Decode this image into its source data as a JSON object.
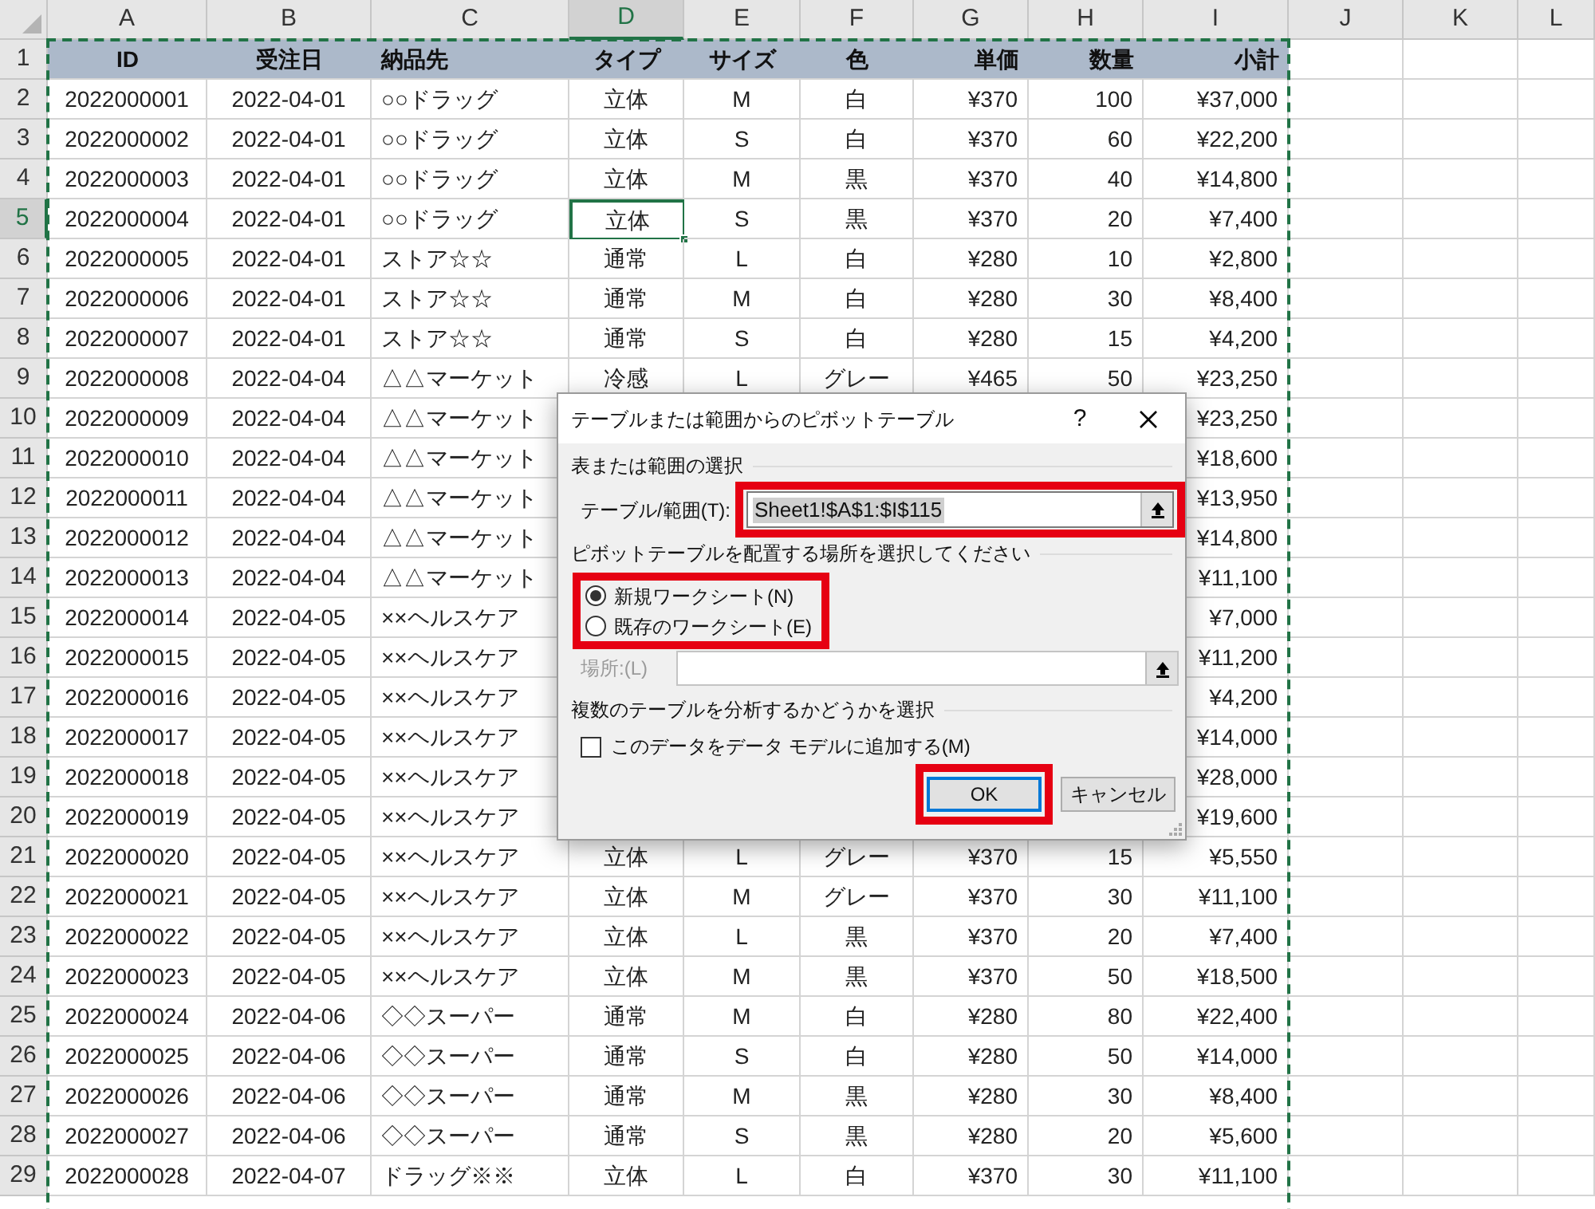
{
  "sheet": {
    "columns": [
      {
        "label": "A",
        "selected": false
      },
      {
        "label": "B",
        "selected": false
      },
      {
        "label": "C",
        "selected": false
      },
      {
        "label": "D",
        "selected": true
      },
      {
        "label": "E",
        "selected": false
      },
      {
        "label": "F",
        "selected": false
      },
      {
        "label": "G",
        "selected": false
      },
      {
        "label": "H",
        "selected": false
      },
      {
        "label": "I",
        "selected": false
      },
      {
        "label": "J",
        "selected": false
      },
      {
        "label": "K",
        "selected": false
      },
      {
        "label": "L",
        "selected": false
      }
    ],
    "header_row": {
      "number": "1",
      "cells": [
        "ID",
        "受注日",
        "納品先",
        "タイプ",
        "サイズ",
        "色",
        "単価",
        "数量",
        "小計"
      ]
    },
    "rows": [
      {
        "number": "2",
        "selected": false,
        "cells": [
          "2022000001",
          "2022-04-01",
          "○○ドラッグ",
          "立体",
          "M",
          "白",
          "¥370",
          "100",
          "¥37,000"
        ]
      },
      {
        "number": "3",
        "selected": false,
        "cells": [
          "2022000002",
          "2022-04-01",
          "○○ドラッグ",
          "立体",
          "S",
          "白",
          "¥370",
          "60",
          "¥22,200"
        ]
      },
      {
        "number": "4",
        "selected": false,
        "cells": [
          "2022000003",
          "2022-04-01",
          "○○ドラッグ",
          "立体",
          "M",
          "黒",
          "¥370",
          "40",
          "¥14,800"
        ]
      },
      {
        "number": "5",
        "selected": true,
        "cells": [
          "2022000004",
          "2022-04-01",
          "○○ドラッグ",
          "立体",
          "S",
          "黒",
          "¥370",
          "20",
          "¥7,400"
        ]
      },
      {
        "number": "6",
        "selected": false,
        "cells": [
          "2022000005",
          "2022-04-01",
          "ストア☆☆",
          "通常",
          "L",
          "白",
          "¥280",
          "10",
          "¥2,800"
        ]
      },
      {
        "number": "7",
        "selected": false,
        "cells": [
          "2022000006",
          "2022-04-01",
          "ストア☆☆",
          "通常",
          "M",
          "白",
          "¥280",
          "30",
          "¥8,400"
        ]
      },
      {
        "number": "8",
        "selected": false,
        "cells": [
          "2022000007",
          "2022-04-01",
          "ストア☆☆",
          "通常",
          "S",
          "白",
          "¥280",
          "15",
          "¥4,200"
        ]
      },
      {
        "number": "9",
        "selected": false,
        "cells": [
          "2022000008",
          "2022-04-04",
          "△△マーケット",
          "冷感",
          "L",
          "グレー",
          "¥465",
          "50",
          "¥23,250"
        ]
      },
      {
        "number": "10",
        "selected": false,
        "cells": [
          "2022000009",
          "2022-04-04",
          "△△マーケット",
          null,
          null,
          null,
          null,
          null,
          "¥23,250"
        ]
      },
      {
        "number": "11",
        "selected": false,
        "cells": [
          "2022000010",
          "2022-04-04",
          "△△マーケット",
          null,
          null,
          null,
          null,
          null,
          "¥18,600"
        ]
      },
      {
        "number": "12",
        "selected": false,
        "cells": [
          "2022000011",
          "2022-04-04",
          "△△マーケット",
          null,
          null,
          null,
          null,
          null,
          "¥13,950"
        ]
      },
      {
        "number": "13",
        "selected": false,
        "cells": [
          "2022000012",
          "2022-04-04",
          "△△マーケット",
          null,
          null,
          null,
          null,
          null,
          "¥14,800"
        ]
      },
      {
        "number": "14",
        "selected": false,
        "cells": [
          "2022000013",
          "2022-04-04",
          "△△マーケット",
          null,
          null,
          null,
          null,
          null,
          "¥11,100"
        ]
      },
      {
        "number": "15",
        "selected": false,
        "cells": [
          "2022000014",
          "2022-04-05",
          "××ヘルスケア",
          null,
          null,
          null,
          null,
          null,
          "¥7,000"
        ]
      },
      {
        "number": "16",
        "selected": false,
        "cells": [
          "2022000015",
          "2022-04-05",
          "××ヘルスケア",
          null,
          null,
          null,
          null,
          null,
          "¥11,200"
        ]
      },
      {
        "number": "17",
        "selected": false,
        "cells": [
          "2022000016",
          "2022-04-05",
          "××ヘルスケア",
          null,
          null,
          null,
          null,
          null,
          "¥4,200"
        ]
      },
      {
        "number": "18",
        "selected": false,
        "cells": [
          "2022000017",
          "2022-04-05",
          "××ヘルスケア",
          null,
          null,
          null,
          null,
          null,
          "¥14,000"
        ]
      },
      {
        "number": "19",
        "selected": false,
        "cells": [
          "2022000018",
          "2022-04-05",
          "××ヘルスケア",
          null,
          null,
          null,
          null,
          null,
          "¥28,000"
        ]
      },
      {
        "number": "20",
        "selected": false,
        "cells": [
          "2022000019",
          "2022-04-05",
          "××ヘルスケア",
          null,
          null,
          null,
          null,
          null,
          "¥19,600"
        ]
      },
      {
        "number": "21",
        "selected": false,
        "cells": [
          "2022000020",
          "2022-04-05",
          "××ヘルスケア",
          "立体",
          "L",
          "グレー",
          "¥370",
          "15",
          "¥5,550"
        ]
      },
      {
        "number": "22",
        "selected": false,
        "cells": [
          "2022000021",
          "2022-04-05",
          "××ヘルスケア",
          "立体",
          "M",
          "グレー",
          "¥370",
          "30",
          "¥11,100"
        ]
      },
      {
        "number": "23",
        "selected": false,
        "cells": [
          "2022000022",
          "2022-04-05",
          "××ヘルスケア",
          "立体",
          "L",
          "黒",
          "¥370",
          "20",
          "¥7,400"
        ]
      },
      {
        "number": "24",
        "selected": false,
        "cells": [
          "2022000023",
          "2022-04-05",
          "××ヘルスケア",
          "立体",
          "M",
          "黒",
          "¥370",
          "50",
          "¥18,500"
        ]
      },
      {
        "number": "25",
        "selected": false,
        "cells": [
          "2022000024",
          "2022-04-06",
          "◇◇スーパー",
          "通常",
          "M",
          "白",
          "¥280",
          "80",
          "¥22,400"
        ]
      },
      {
        "number": "26",
        "selected": false,
        "cells": [
          "2022000025",
          "2022-04-06",
          "◇◇スーパー",
          "通常",
          "S",
          "白",
          "¥280",
          "50",
          "¥14,000"
        ]
      },
      {
        "number": "27",
        "selected": false,
        "cells": [
          "2022000026",
          "2022-04-06",
          "◇◇スーパー",
          "通常",
          "M",
          "黒",
          "¥280",
          "30",
          "¥8,400"
        ]
      },
      {
        "number": "28",
        "selected": false,
        "cells": [
          "2022000027",
          "2022-04-06",
          "◇◇スーパー",
          "通常",
          "S",
          "黒",
          "¥280",
          "20",
          "¥5,600"
        ]
      },
      {
        "number": "29",
        "selected": false,
        "cells": [
          "2022000028",
          "2022-04-07",
          "ドラッグ※※",
          "立体",
          "L",
          "白",
          "¥370",
          "30",
          "¥11,100"
        ]
      }
    ]
  },
  "dialog": {
    "title": "テーブルまたは範囲からのピボットテーブル",
    "help": "?",
    "source_section": {
      "heading": "表または範囲の選択",
      "label": "テーブル/範囲(T):",
      "value": "Sheet1!$A$1:$I$115"
    },
    "placement_section": {
      "heading": "ピボットテーブルを配置する場所を選択してください",
      "options": [
        {
          "label": "新規ワークシート(N)",
          "selected": true
        },
        {
          "label": "既存のワークシート(E)",
          "selected": false
        }
      ],
      "location": {
        "label": "場所:(L)",
        "disabled": true
      }
    },
    "model_section": {
      "heading": "複数のテーブルを分析するかどうかを選択",
      "checkbox": {
        "label": "このデータをデータ モデルに追加する(M)",
        "checked": false
      }
    },
    "buttons": [
      {
        "label": "OK",
        "kind": "default"
      },
      {
        "label": "キャンセル",
        "kind": "normal"
      }
    ]
  }
}
